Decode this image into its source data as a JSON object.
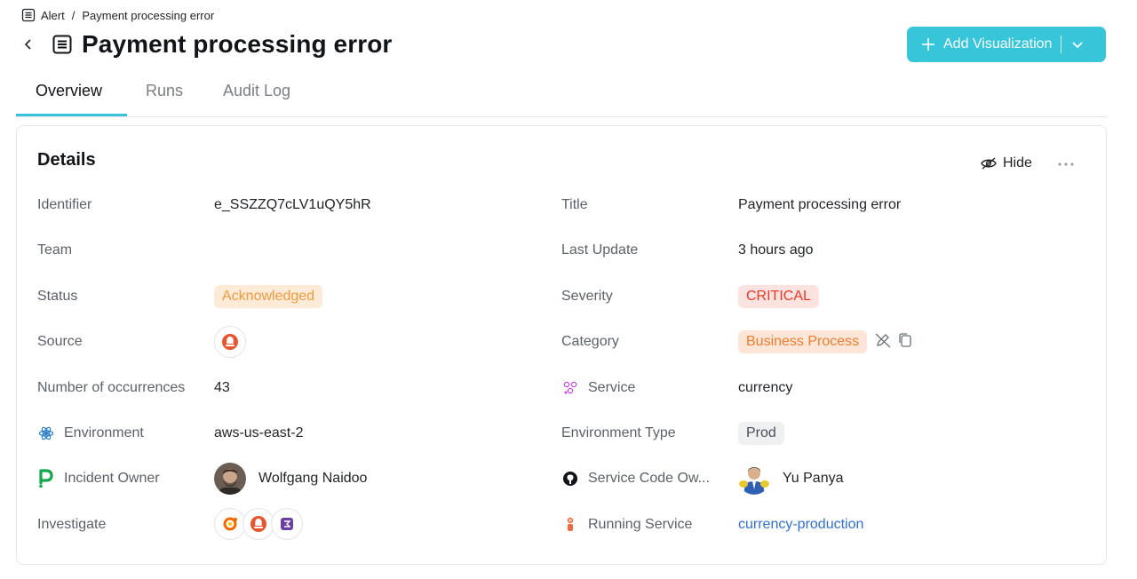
{
  "breadcrumb": {
    "parent": "Alert",
    "separator": "/",
    "current": "Payment processing error"
  },
  "header": {
    "title": "Payment processing error",
    "add_visualization": "Add Visualization"
  },
  "tabs": [
    {
      "label": "Overview"
    },
    {
      "label": "Runs"
    },
    {
      "label": "Audit Log"
    }
  ],
  "details": {
    "title": "Details",
    "hide_label": "Hide",
    "left": {
      "identifier": {
        "label": "Identifier",
        "value": "e_SSZZQ7cLV1uQY5hR"
      },
      "team": {
        "label": "Team",
        "value": ""
      },
      "status": {
        "label": "Status",
        "value": "Acknowledged"
      },
      "source": {
        "label": "Source",
        "icon": "alert-source-icon"
      },
      "occurrences": {
        "label": "Number of occurrences",
        "value": "43"
      },
      "environment": {
        "label": "Environment",
        "value": "aws-us-east-2",
        "icon": "environment-icon"
      },
      "incident_owner": {
        "label": "Incident Owner",
        "value": "Wolfgang Naidoo",
        "icon": "pagerduty-icon"
      },
      "investigate": {
        "label": "Investigate",
        "icons": [
          "grafana-icon",
          "alert-source-icon",
          "notebook-icon"
        ]
      }
    },
    "right": {
      "title": {
        "label": "Title",
        "value": "Payment processing error"
      },
      "last_update": {
        "label": "Last Update",
        "value": "3 hours ago"
      },
      "severity": {
        "label": "Severity",
        "value": "CRITICAL"
      },
      "category": {
        "label": "Category",
        "value": "Business Process"
      },
      "service": {
        "label": "Service",
        "value": "currency",
        "icon": "service-icon"
      },
      "environment_type": {
        "label": "Environment Type",
        "value": "Prod"
      },
      "service_code_owner": {
        "label": "Service Code Ow...",
        "value": "Yu Panya",
        "icon": "github-icon"
      },
      "running_service": {
        "label": "Running Service",
        "value": "currency-production",
        "icon": "running-service-icon"
      }
    }
  },
  "colors": {
    "accent": "#36c5d9",
    "acknowledged": "#f19a3e",
    "critical": "#e5392a",
    "business": "#f07c2c",
    "link": "#2f6fd6"
  }
}
